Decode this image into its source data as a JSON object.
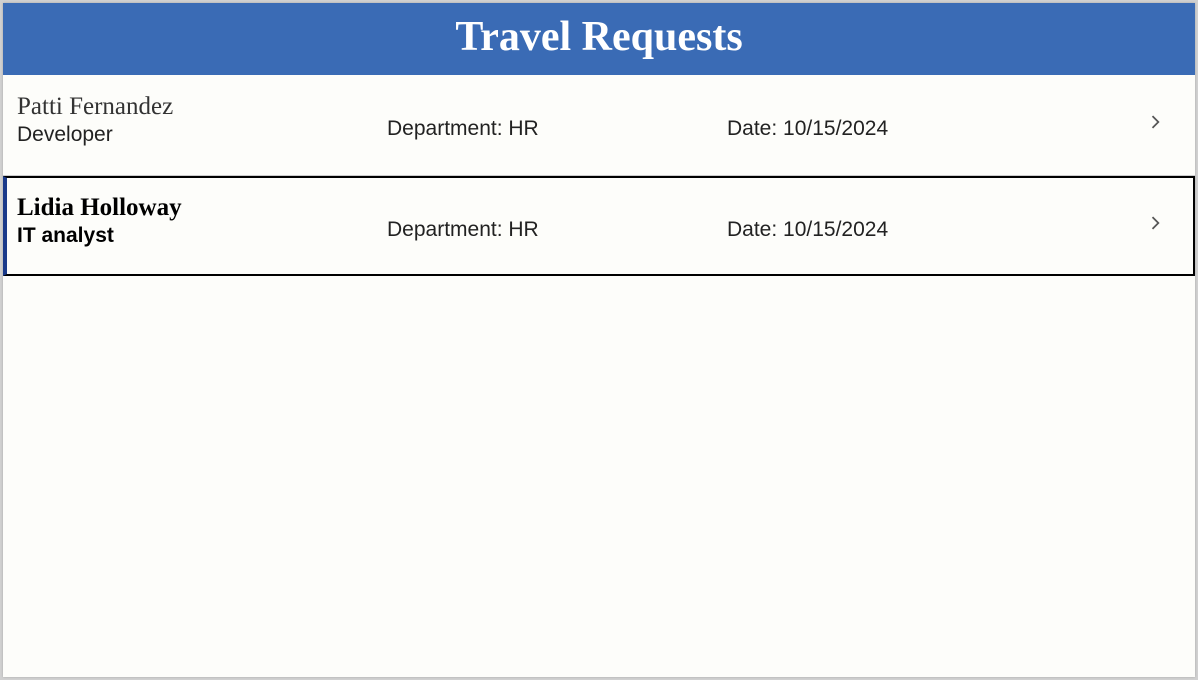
{
  "header": {
    "title": "Travel Requests"
  },
  "labels": {
    "department_prefix": "Department: ",
    "date_prefix": "Date: "
  },
  "requests": [
    {
      "name": "Patti Fernandez",
      "role": "Developer",
      "department": "HR",
      "date": "10/15/2024",
      "selected": false
    },
    {
      "name": "Lidia Holloway",
      "role": "IT analyst",
      "department": "HR",
      "date": "10/15/2024",
      "selected": true
    }
  ]
}
